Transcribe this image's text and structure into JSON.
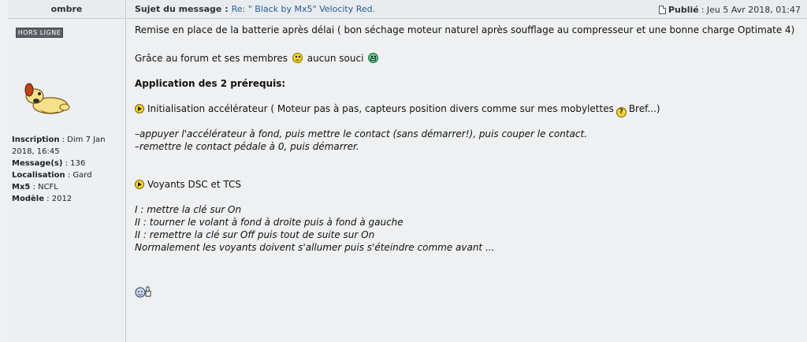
{
  "header": {
    "author": "ombre",
    "subject_label": "Sujet du message :",
    "subject": "Re: \" Black by Mx5\" Velocity Red.",
    "published_label": "Publié",
    "published_date": ": Jeu 5 Avr 2018, 01:47"
  },
  "author": {
    "status": "HORS LIGNE",
    "avatar_icon": "cartoon-dog-avatar",
    "fields": [
      {
        "key": "Inscription",
        "value": ": Dim 7 Jan 2018, 16:45"
      },
      {
        "key": "Message(s)",
        "value": ": 136"
      },
      {
        "key": "Localisation",
        "value": ": Gard"
      },
      {
        "key": "Mx5",
        "value": ": NCFL"
      },
      {
        "key": "Modèle",
        "value": ": 2012"
      }
    ]
  },
  "message": {
    "p1": "Remise en place de la batterie après délai ( bon séchage moteur naturel après soufflage au compresseur et une bonne charge Optimate 4)",
    "p2_a": "Grâce au forum et ses membres",
    "p2_b": "aucun souci",
    "heading": "Application des 2 prérequis:",
    "item1_a": "Initialisation accélérateur ( Moteur pas à pas, capteurs position divers comme sur mes mobylettes",
    "item1_b": "Bref...)",
    "step1": "–appuyer l'accélérateur à fond, puis mettre le contact (sans démarrer!), puis couper le contact.",
    "step2": "–remettre le contact pédale à 0, puis démarrer.",
    "item2": "Voyants DSC et TCS",
    "v1": "I : mettre la clé sur On",
    "v2": "II : tourner le volant à fond à droite puis à fond à gauche",
    "v3": "II : remettre la clé sur Off puis tout de suite sur On",
    "v4": "Normalement les voyants doivent s'allumer puis s'éteindre comme avant ..."
  }
}
